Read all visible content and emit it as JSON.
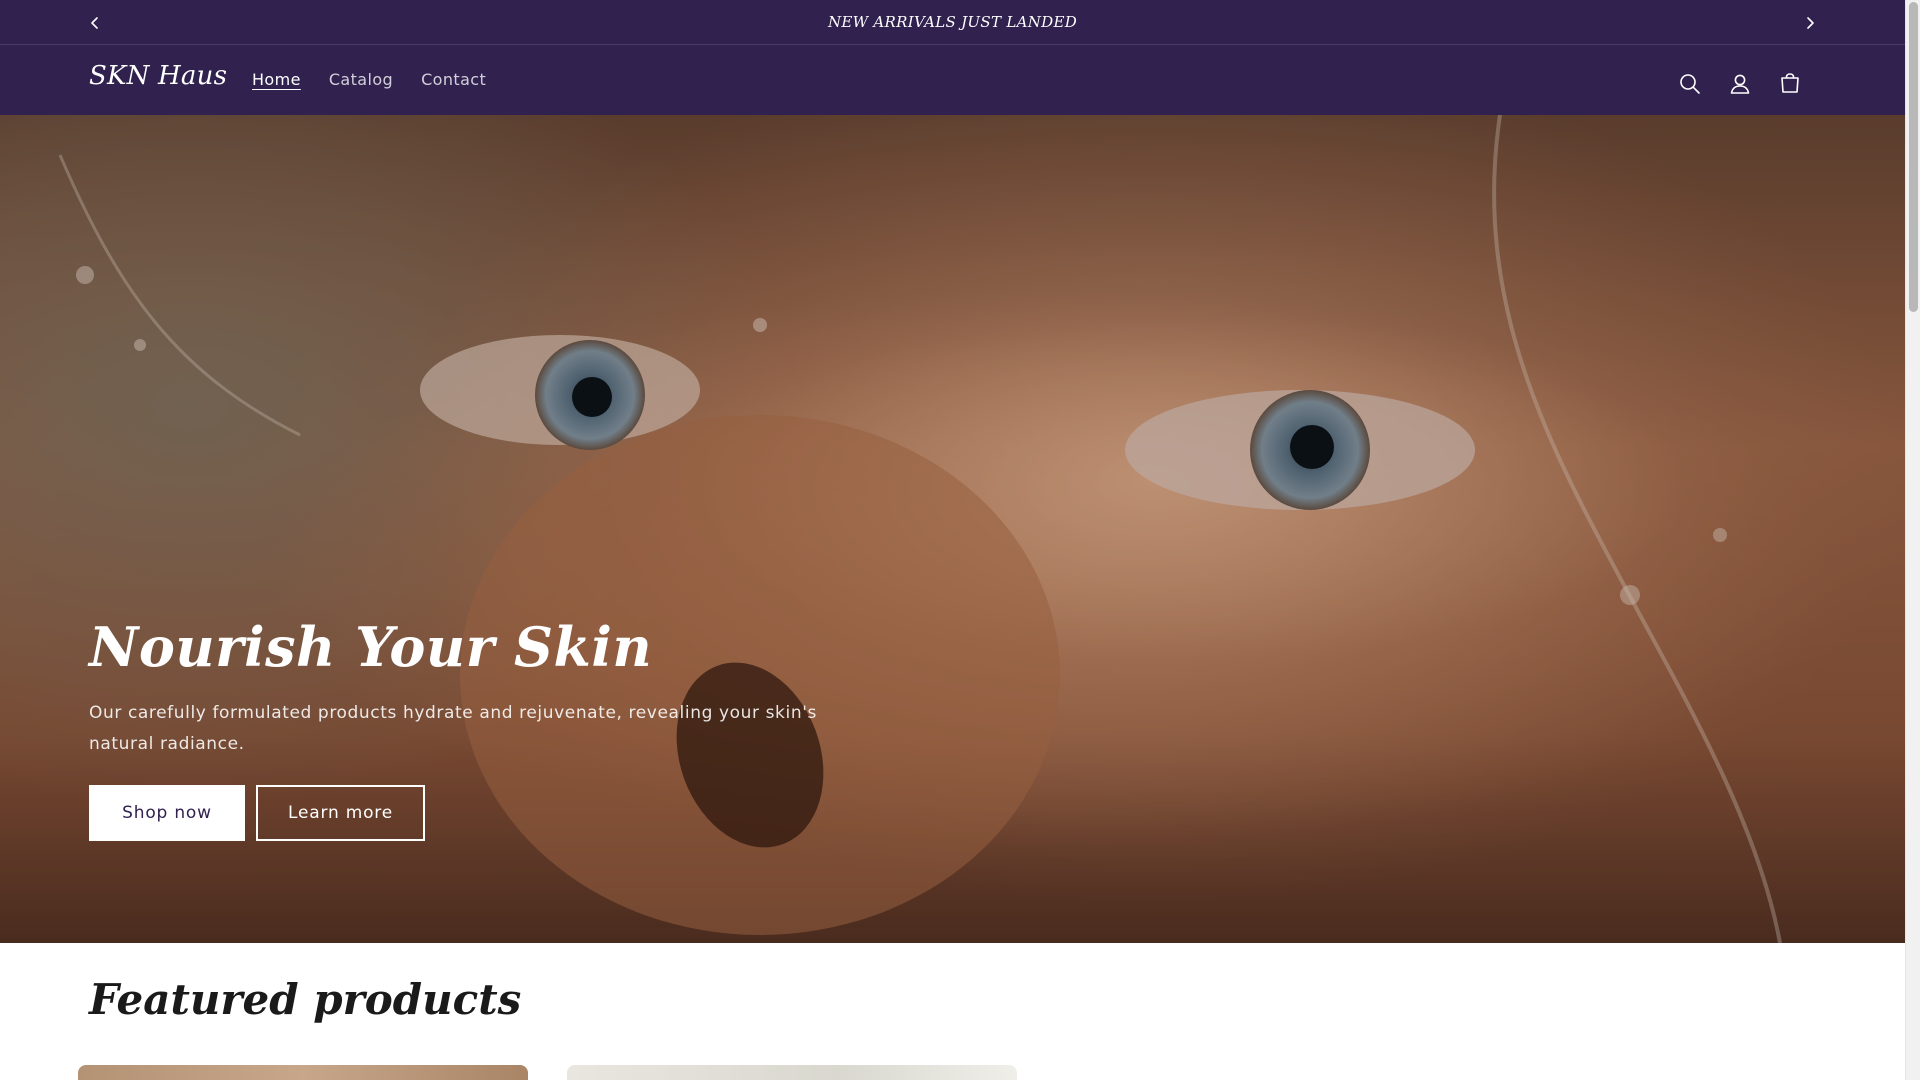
{
  "announcement": {
    "text": "NEW ARRIVALS JUST LANDED",
    "prev_icon": "chevron-left-icon",
    "next_icon": "chevron-right-icon"
  },
  "header": {
    "logo": "SKN Haus",
    "nav": [
      {
        "label": "Home",
        "active": true
      },
      {
        "label": "Catalog",
        "active": false
      },
      {
        "label": "Contact",
        "active": false
      }
    ],
    "icons": [
      "search-icon",
      "account-icon",
      "cart-icon"
    ]
  },
  "hero": {
    "title": "Nourish Your Skin",
    "text": "Our carefully formulated products hydrate and rejuvenate, revealing your skin's natural radiance.",
    "primary_button": "Shop now",
    "secondary_button": "Learn more"
  },
  "featured": {
    "title": "Featured products"
  },
  "colors": {
    "brand": "#30214f",
    "button_bg": "#ffffff",
    "text_dark": "#1a1a1a"
  }
}
